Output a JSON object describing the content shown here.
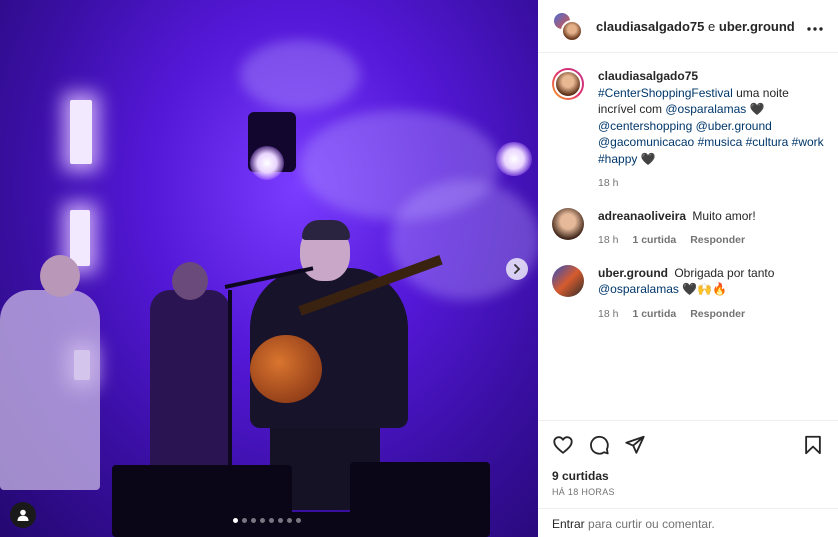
{
  "header": {
    "user1": "claudiasalgado75",
    "connector": "e",
    "user2": "uber.ground",
    "more_icon": "ellipsis-icon"
  },
  "caption": {
    "username": "claudiasalgado75",
    "parts": {
      "hashtag1": "#CenterShoppingFestival",
      "text1": "uma noite incrível com",
      "mention1": "@osparalamas",
      "heart": "🖤",
      "mention2": "@centershopping",
      "mention3": "@uber.ground",
      "mention4": "@gacomunicacao",
      "hashtag2": "#musica",
      "hashtag3": "#cultura",
      "hashtag4": "#work",
      "hashtag5": "#happy",
      "heart2": "🖤"
    },
    "time": "18 h"
  },
  "comments": [
    {
      "username": "adreanaoliveira",
      "text": "Muito amor!",
      "time": "18 h",
      "likes": "1 curtida",
      "reply": "Responder"
    },
    {
      "username": "uber.ground",
      "text": "Obrigada por tanto",
      "mention": "@osparalamas",
      "emojis": "🖤🙌🔥",
      "time": "18 h",
      "likes": "1 curtida",
      "reply": "Responder"
    }
  ],
  "actions": {
    "likes": "9 curtidas",
    "time": "HÁ 18 HORAS"
  },
  "add_comment": {
    "login": "Entrar",
    "text": "para curtir ou comentar."
  },
  "carousel": {
    "total": 8,
    "active": 1,
    "next_icon": "chevron-right-icon",
    "tag_icon": "user-tag-icon"
  }
}
